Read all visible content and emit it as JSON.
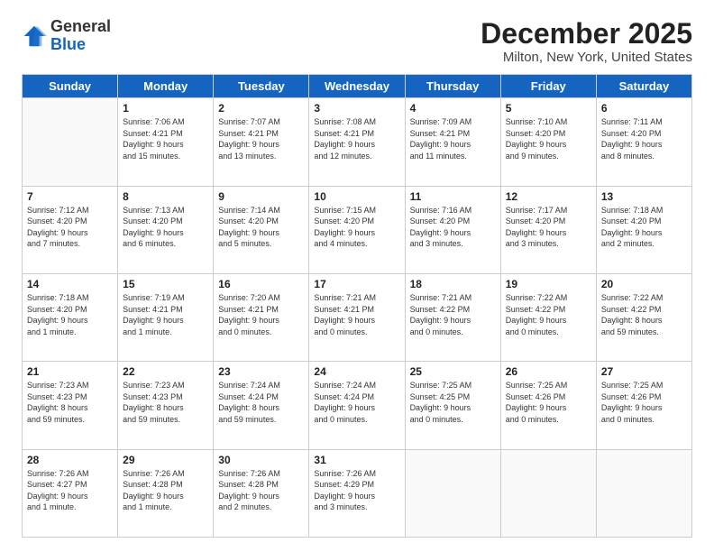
{
  "logo": {
    "general": "General",
    "blue": "Blue"
  },
  "header": {
    "title": "December 2025",
    "subtitle": "Milton, New York, United States"
  },
  "weekdays": [
    "Sunday",
    "Monday",
    "Tuesday",
    "Wednesday",
    "Thursday",
    "Friday",
    "Saturday"
  ],
  "weeks": [
    [
      {
        "day": "",
        "info": ""
      },
      {
        "day": "1",
        "info": "Sunrise: 7:06 AM\nSunset: 4:21 PM\nDaylight: 9 hours\nand 15 minutes."
      },
      {
        "day": "2",
        "info": "Sunrise: 7:07 AM\nSunset: 4:21 PM\nDaylight: 9 hours\nand 13 minutes."
      },
      {
        "day": "3",
        "info": "Sunrise: 7:08 AM\nSunset: 4:21 PM\nDaylight: 9 hours\nand 12 minutes."
      },
      {
        "day": "4",
        "info": "Sunrise: 7:09 AM\nSunset: 4:21 PM\nDaylight: 9 hours\nand 11 minutes."
      },
      {
        "day": "5",
        "info": "Sunrise: 7:10 AM\nSunset: 4:20 PM\nDaylight: 9 hours\nand 9 minutes."
      },
      {
        "day": "6",
        "info": "Sunrise: 7:11 AM\nSunset: 4:20 PM\nDaylight: 9 hours\nand 8 minutes."
      }
    ],
    [
      {
        "day": "7",
        "info": "Sunrise: 7:12 AM\nSunset: 4:20 PM\nDaylight: 9 hours\nand 7 minutes."
      },
      {
        "day": "8",
        "info": "Sunrise: 7:13 AM\nSunset: 4:20 PM\nDaylight: 9 hours\nand 6 minutes."
      },
      {
        "day": "9",
        "info": "Sunrise: 7:14 AM\nSunset: 4:20 PM\nDaylight: 9 hours\nand 5 minutes."
      },
      {
        "day": "10",
        "info": "Sunrise: 7:15 AM\nSunset: 4:20 PM\nDaylight: 9 hours\nand 4 minutes."
      },
      {
        "day": "11",
        "info": "Sunrise: 7:16 AM\nSunset: 4:20 PM\nDaylight: 9 hours\nand 3 minutes."
      },
      {
        "day": "12",
        "info": "Sunrise: 7:17 AM\nSunset: 4:20 PM\nDaylight: 9 hours\nand 3 minutes."
      },
      {
        "day": "13",
        "info": "Sunrise: 7:18 AM\nSunset: 4:20 PM\nDaylight: 9 hours\nand 2 minutes."
      }
    ],
    [
      {
        "day": "14",
        "info": "Sunrise: 7:18 AM\nSunset: 4:20 PM\nDaylight: 9 hours\nand 1 minute."
      },
      {
        "day": "15",
        "info": "Sunrise: 7:19 AM\nSunset: 4:21 PM\nDaylight: 9 hours\nand 1 minute."
      },
      {
        "day": "16",
        "info": "Sunrise: 7:20 AM\nSunset: 4:21 PM\nDaylight: 9 hours\nand 0 minutes."
      },
      {
        "day": "17",
        "info": "Sunrise: 7:21 AM\nSunset: 4:21 PM\nDaylight: 9 hours\nand 0 minutes."
      },
      {
        "day": "18",
        "info": "Sunrise: 7:21 AM\nSunset: 4:22 PM\nDaylight: 9 hours\nand 0 minutes."
      },
      {
        "day": "19",
        "info": "Sunrise: 7:22 AM\nSunset: 4:22 PM\nDaylight: 9 hours\nand 0 minutes."
      },
      {
        "day": "20",
        "info": "Sunrise: 7:22 AM\nSunset: 4:22 PM\nDaylight: 8 hours\nand 59 minutes."
      }
    ],
    [
      {
        "day": "21",
        "info": "Sunrise: 7:23 AM\nSunset: 4:23 PM\nDaylight: 8 hours\nand 59 minutes."
      },
      {
        "day": "22",
        "info": "Sunrise: 7:23 AM\nSunset: 4:23 PM\nDaylight: 8 hours\nand 59 minutes."
      },
      {
        "day": "23",
        "info": "Sunrise: 7:24 AM\nSunset: 4:24 PM\nDaylight: 8 hours\nand 59 minutes."
      },
      {
        "day": "24",
        "info": "Sunrise: 7:24 AM\nSunset: 4:24 PM\nDaylight: 9 hours\nand 0 minutes."
      },
      {
        "day": "25",
        "info": "Sunrise: 7:25 AM\nSunset: 4:25 PM\nDaylight: 9 hours\nand 0 minutes."
      },
      {
        "day": "26",
        "info": "Sunrise: 7:25 AM\nSunset: 4:26 PM\nDaylight: 9 hours\nand 0 minutes."
      },
      {
        "day": "27",
        "info": "Sunrise: 7:25 AM\nSunset: 4:26 PM\nDaylight: 9 hours\nand 0 minutes."
      }
    ],
    [
      {
        "day": "28",
        "info": "Sunrise: 7:26 AM\nSunset: 4:27 PM\nDaylight: 9 hours\nand 1 minute."
      },
      {
        "day": "29",
        "info": "Sunrise: 7:26 AM\nSunset: 4:28 PM\nDaylight: 9 hours\nand 1 minute."
      },
      {
        "day": "30",
        "info": "Sunrise: 7:26 AM\nSunset: 4:28 PM\nDaylight: 9 hours\nand 2 minutes."
      },
      {
        "day": "31",
        "info": "Sunrise: 7:26 AM\nSunset: 4:29 PM\nDaylight: 9 hours\nand 3 minutes."
      },
      {
        "day": "",
        "info": ""
      },
      {
        "day": "",
        "info": ""
      },
      {
        "day": "",
        "info": ""
      }
    ]
  ]
}
